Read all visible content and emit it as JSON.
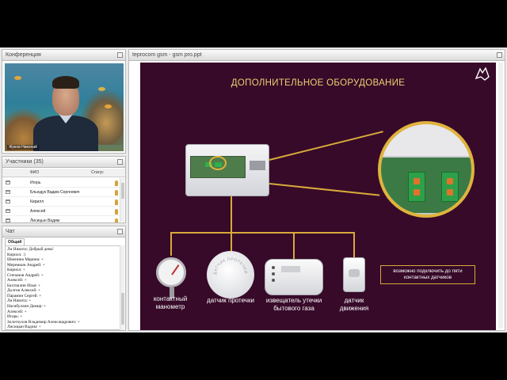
{
  "conference": {
    "title": "Конференция",
    "presenter_name": "Жуков Николай"
  },
  "participants": {
    "title": "Участники (35)",
    "columns": [
      "ФИО",
      "Статус"
    ],
    "rows": [
      {
        "name": "Игорь"
      },
      {
        "name": "Бльюдук Вадим   Сергеевич"
      },
      {
        "name": "Кирилл"
      },
      {
        "name": "Алексей"
      },
      {
        "name": "Лисицын Вадим"
      }
    ]
  },
  "chat": {
    "title": "Чат",
    "tab": "Общий",
    "messages": [
      "Ли Никита: Добрый день!",
      "Кирилл: :)",
      "Шкенина Марина: +",
      "Меремкин Андрей: +",
      "Кирилл: +",
      "Степанов Андрей: +",
      "Алексей: +",
      "Бахтиалин Илья: +",
      "Долгов Алексей: +",
      "Парамин Сергей: +",
      "Ли Никита: +",
      "Насибуллин  Дамир: +",
      "Алексей: +",
      "Игорь: +",
      "Золотоухов Владимир  Александрович: +",
      "Лисицын Вадим: +"
    ]
  },
  "presentation": {
    "title": "teprocom gsm - gsm pro.ppt",
    "slide": {
      "heading": "ДОПОЛНИТЕЛЬНОЕ ОБОРУДОВАНИЕ",
      "sensors": [
        {
          "label": "контактный манометр",
          "icon": "pressure-gauge-icon"
        },
        {
          "label": "датчик протечки",
          "icon": "leak-sensor-icon"
        },
        {
          "label": "извещатель утечки бытового газа",
          "icon": "gas-detector-icon"
        },
        {
          "label": "датчик движения",
          "icon": "motion-sensor-icon"
        }
      ],
      "note": "возможно подключить до пяти контактных датчиков",
      "disc_text": "ДАТЧИК ПРОТЕЧКИ",
      "colors": {
        "background": "#370a29",
        "accent": "#d8aa3a",
        "heading": "#eecf72"
      }
    }
  }
}
